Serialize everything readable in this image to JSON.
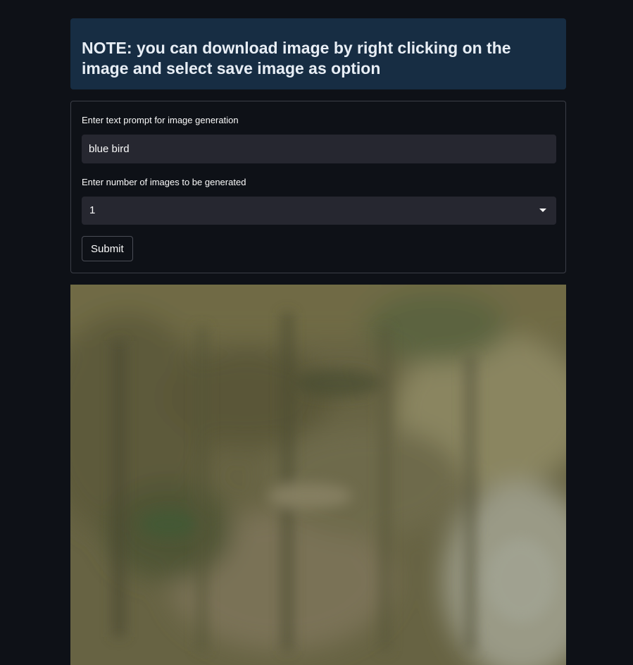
{
  "notice": {
    "text": "NOTE: you can download image by right clicking on the image and select save image as option"
  },
  "form": {
    "prompt_label": "Enter text prompt for image generation",
    "prompt_value": "blue bird",
    "count_label": "Enter number of images to be generated",
    "count_value": "1",
    "submit_label": "Submit"
  },
  "icons": {
    "select_chevron": "chevron-down-icon"
  },
  "colors": {
    "background": "#0e1117",
    "notice_background": "#172d43",
    "input_background": "#262730"
  }
}
